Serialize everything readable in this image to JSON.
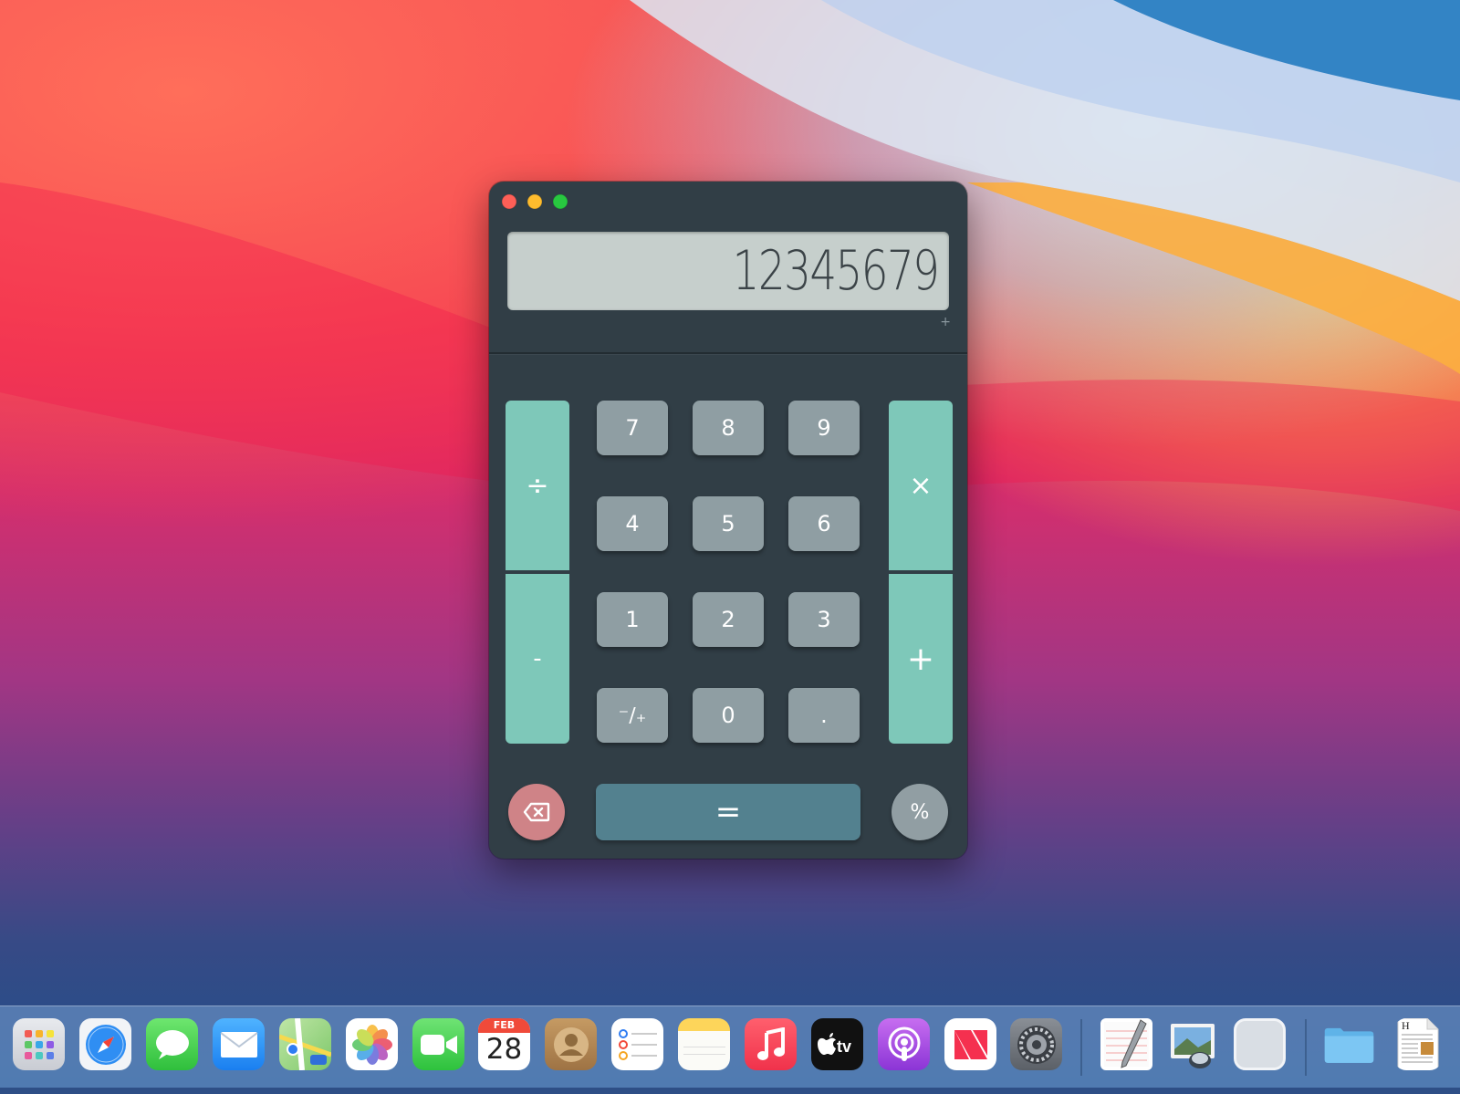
{
  "calculator": {
    "display": "12345679",
    "op_indicator": "+",
    "keys": {
      "divide": "÷",
      "minus": "-",
      "multiply": "×",
      "plus": "+",
      "seven": "7",
      "eight": "8",
      "nine": "9",
      "four": "4",
      "five": "5",
      "six": "6",
      "one": "1",
      "two": "2",
      "three": "3",
      "plusminus": "⁻∕₊",
      "zero": "0",
      "dot": ".",
      "equals": "=",
      "percent": "%"
    },
    "colors": {
      "body": "#313e46",
      "display_bg": "#c6cfcc",
      "operator": "#7ec8b9",
      "number": "#8f9ea3",
      "equals": "#53818f",
      "backspace": "#cf8387"
    }
  },
  "dock": {
    "calendar": {
      "month": "FEB",
      "day": "28"
    },
    "apps": [
      "launchpad",
      "safari",
      "messages",
      "mail",
      "maps",
      "photos",
      "facetime",
      "calendar",
      "contacts",
      "reminders",
      "notes",
      "music",
      "tv",
      "podcasts",
      "news",
      "system-preferences",
      "textedit",
      "preview",
      "blank-app",
      "downloads-folder",
      "document"
    ]
  }
}
